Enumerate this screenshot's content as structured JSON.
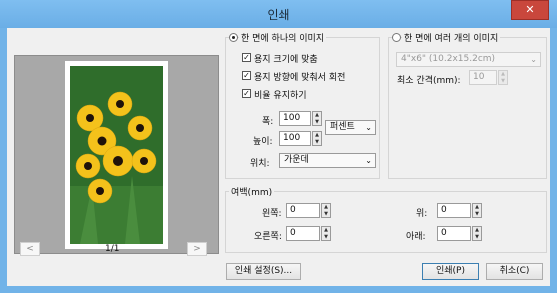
{
  "window": {
    "title": "인쇄",
    "close_glyph": "✕"
  },
  "preview": {
    "page_indicator": "1/1",
    "prev_label": "<",
    "next_label": ">"
  },
  "single_image": {
    "radio_label": "한 면에 하나의 이미지",
    "selected": true,
    "checkboxes": [
      {
        "label": "용지 크기에 맞춤",
        "checked": true
      },
      {
        "label": "용지 방향에 맞춰서 회전",
        "checked": true
      },
      {
        "label": "비율 유지하기",
        "checked": true
      }
    ],
    "width_label": "폭:",
    "width_value": "100",
    "height_label": "높이:",
    "height_value": "100",
    "unit_value": "퍼센트",
    "position_label": "위치:",
    "position_value": "가운데"
  },
  "multi_image": {
    "radio_label": "한 면에 여러 개의 이미지",
    "selected": false,
    "size_value": "4\"x6\" (10.2x15.2cm)",
    "min_spacing_label": "최소 간격(mm):",
    "min_spacing_value": "10"
  },
  "margins": {
    "title": "여백(mm)",
    "left_label": "왼쪽:",
    "left_value": "0",
    "right_label": "오른쪽:",
    "right_value": "0",
    "top_label": "위:",
    "top_value": "0",
    "bottom_label": "아래:",
    "bottom_value": "0"
  },
  "buttons": {
    "print_setup": "인쇄 설정(S)...",
    "print": "인쇄(P)",
    "cancel": "취소(C)"
  }
}
